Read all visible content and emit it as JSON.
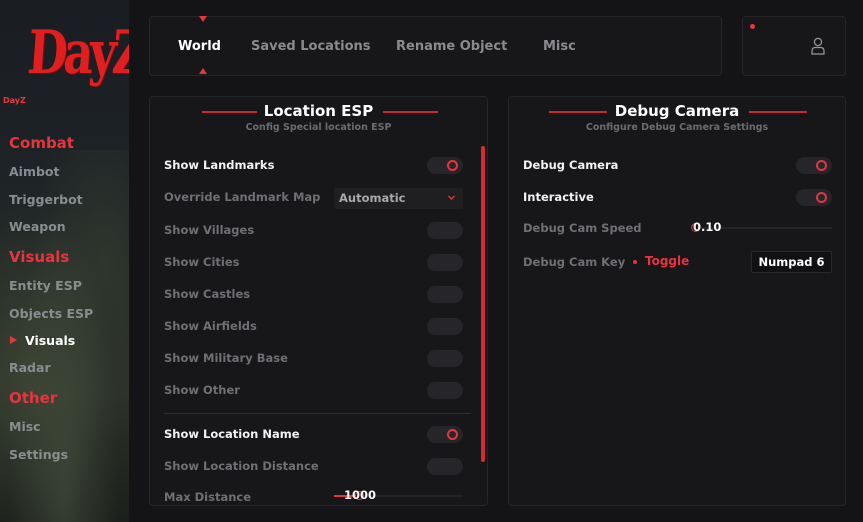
{
  "app": {
    "logo_text": "DayZ",
    "brand_name": "DayZ"
  },
  "sidebar": {
    "categories": [
      {
        "label": "Combat",
        "items": [
          "Aimbot",
          "Triggerbot",
          "Weapon"
        ]
      },
      {
        "label": "Visuals",
        "items": [
          "Entity ESP",
          "Objects ESP",
          "Visuals",
          "Radar"
        ]
      },
      {
        "label": "Other",
        "items": [
          "Misc",
          "Settings"
        ]
      }
    ],
    "active_item": "Visuals"
  },
  "tabs": [
    "World",
    "Saved Locations",
    "Rename Object",
    "Misc"
  ],
  "active_tab": "World",
  "location_esp": {
    "title": "Location ESP",
    "subtitle": "Config Special location ESP",
    "show_landmarks": {
      "label": "Show Landmarks",
      "enabled": true
    },
    "override_map": {
      "label": "Override Landmark Map",
      "value": "Automatic"
    },
    "toggles": [
      {
        "label": "Show Villages",
        "enabled": false
      },
      {
        "label": "Show Cities",
        "enabled": false
      },
      {
        "label": "Show Castles",
        "enabled": false
      },
      {
        "label": "Show Airfields",
        "enabled": false
      },
      {
        "label": "Show Military Base",
        "enabled": false
      },
      {
        "label": "Show Other",
        "enabled": false
      }
    ],
    "show_location_name": {
      "label": "Show Location Name",
      "enabled": true
    },
    "show_location_distance": {
      "label": "Show Location Distance",
      "enabled": false
    },
    "max_distance": {
      "label": "Max Distance",
      "value": "1000"
    }
  },
  "debug_camera": {
    "title": "Debug Camera",
    "subtitle": "Configure Debug Camera Settings",
    "debug_camera": {
      "label": "Debug Camera",
      "enabled": true
    },
    "interactive": {
      "label": "Interactive",
      "enabled": true
    },
    "cam_speed": {
      "label": "Debug Cam Speed",
      "value": "0.10"
    },
    "cam_key": {
      "label": "Debug Cam Key",
      "mode": "Toggle",
      "key": "Numpad 6"
    }
  },
  "colors": {
    "accent": "#e8343c",
    "panel": "#17171a",
    "background": "#141416"
  },
  "icons": {
    "profile": "user-icon",
    "dropdown": "chevron-down-icon",
    "nav_bullet": "triangle-right-icon"
  }
}
